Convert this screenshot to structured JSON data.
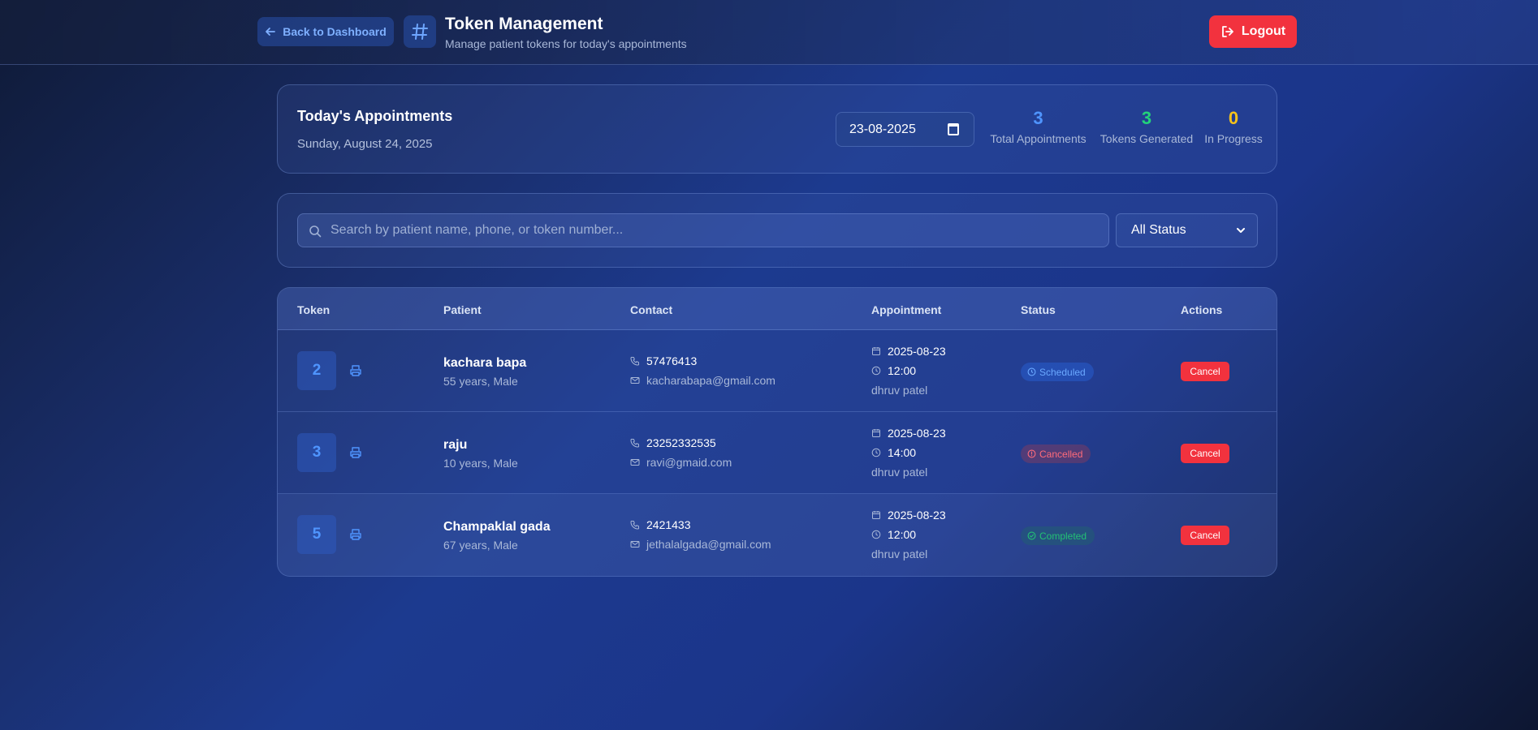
{
  "header": {
    "back_label": "Back to Dashboard",
    "title": "Token Management",
    "subtitle": "Manage patient tokens for today's appointments",
    "logout_label": "Logout"
  },
  "appointments": {
    "title": "Today's Appointments",
    "date_text": "Sunday, August 24, 2025",
    "date_input_value": "23-08-2025",
    "stats": [
      {
        "value": "3",
        "label": "Total Appointments",
        "color": "#4f95ff"
      },
      {
        "value": "3",
        "label": "Tokens Generated",
        "color": "#23d27a"
      },
      {
        "value": "0",
        "label": "In Progress",
        "color": "#f5c21b"
      }
    ]
  },
  "filters": {
    "search_placeholder": "Search by patient name, phone, or token number...",
    "status_selected": "All Status"
  },
  "table": {
    "headers": {
      "token": "Token",
      "patient": "Patient",
      "contact": "Contact",
      "appointment": "Appointment",
      "status": "Status",
      "actions": "Actions"
    },
    "rows": [
      {
        "token": "2",
        "name": "kachara bapa",
        "meta": "55 years, Male",
        "phone": "57476413",
        "email": "kacharabapa@gmail.com",
        "date": "2025-08-23",
        "time": "12:00",
        "doctor": "dhruv patel",
        "status": "Scheduled",
        "action": "Cancel"
      },
      {
        "token": "3",
        "name": "raju",
        "meta": "10 years, Male",
        "phone": "23252332535",
        "email": "ravi@gmaid.com",
        "date": "2025-08-23",
        "time": "14:00",
        "doctor": "dhruv patel",
        "status": "Cancelled",
        "action": "Cancel"
      },
      {
        "token": "5",
        "name": "Champaklal gada",
        "meta": "67 years, Male",
        "phone": "2421433",
        "email": "jethalalgada@gmail.com",
        "date": "2025-08-23",
        "time": "12:00",
        "doctor": "dhruv patel",
        "status": "Completed",
        "action": "Cancel"
      }
    ]
  },
  "colors": {
    "accent": "#4f95ff",
    "danger": "#f2323e",
    "success": "#23d27a",
    "warning": "#f5c21b"
  }
}
